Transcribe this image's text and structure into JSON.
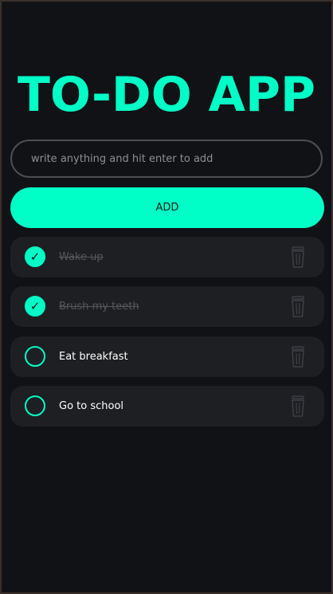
{
  "app": {
    "title": "TO-DO APP"
  },
  "input": {
    "placeholder": "write anything and hit enter to add",
    "value": ""
  },
  "add_button": {
    "label": "ADD"
  },
  "todos": [
    {
      "label": "Wake up",
      "done": true
    },
    {
      "label": "Brush my teeth",
      "done": true
    },
    {
      "label": "Eat breakfast",
      "done": false
    },
    {
      "label": "Go to school",
      "done": false
    }
  ],
  "icons": {
    "check": "checkmark-icon",
    "delete": "trash-icon"
  },
  "colors": {
    "background": "#111216",
    "accent": "#00ffc6",
    "card": "#1e1f23",
    "input_border": "#4c4e54",
    "placeholder": "#8d8f94",
    "done_text": "#55575c",
    "trash": "#3d3f44",
    "text": "#ffffff"
  }
}
